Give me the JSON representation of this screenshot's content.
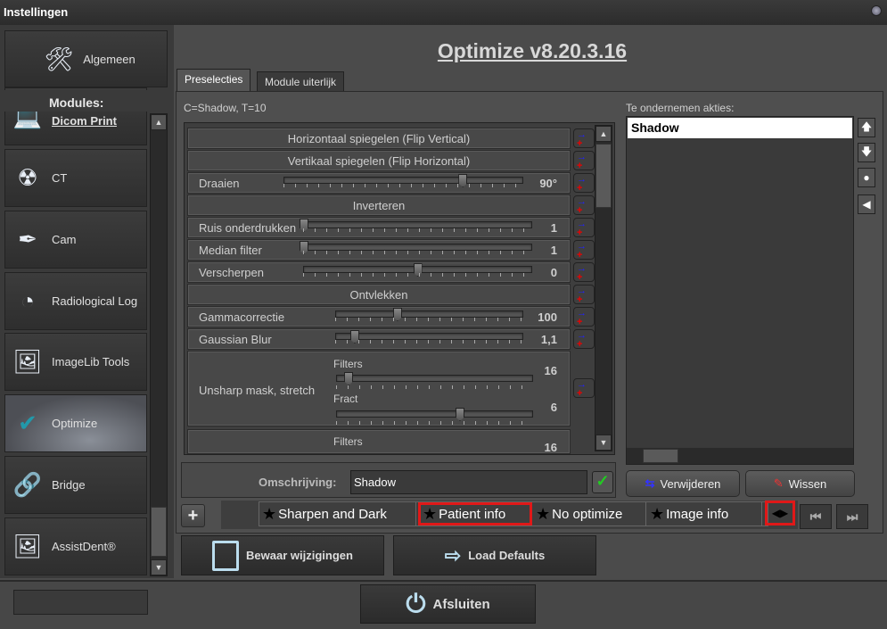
{
  "window": {
    "title": "Instellingen"
  },
  "sidebar": {
    "top_button": {
      "label": "Algemeen",
      "icon": "tools-icon"
    },
    "modules_label": "Modules:",
    "items": [
      {
        "label": "Dicom Print",
        "icon": "laptop-icon",
        "selected": false
      },
      {
        "label": "CT",
        "icon": "radiation-icon",
        "selected": false
      },
      {
        "label": "Cam",
        "icon": "camera-pen-icon",
        "icon_text": "CAM",
        "selected": false
      },
      {
        "label": "Radiological Log",
        "icon": "radiological-log-icon",
        "selected": false
      },
      {
        "label": "ImageLib Tools",
        "icon": "image-gear-icon",
        "selected": false
      },
      {
        "label": "Optimize",
        "icon": "checkmark-icon",
        "selected": true
      },
      {
        "label": "Bridge",
        "icon": "link-icon",
        "selected": false
      },
      {
        "label": "AssistDent®",
        "icon": "image-gear-icon",
        "selected": false
      }
    ]
  },
  "main": {
    "title": "Optimize v8.20.3.16",
    "tabs": [
      {
        "label": "Preselecties",
        "active": true
      },
      {
        "label": "Module uiterlijk",
        "active": false
      }
    ],
    "info": "C=Shadow, T=10",
    "rows": [
      {
        "type": "button",
        "label": "Horizontaal spiegelen (Flip Vertical)"
      },
      {
        "type": "button",
        "label": "Vertikaal spiegelen (Flip Horizontal)"
      },
      {
        "type": "slider",
        "label": "Draaien",
        "value": "90°",
        "fraction": 0.75
      },
      {
        "type": "button",
        "label": "Inverteren"
      },
      {
        "type": "slider",
        "label": "Ruis onderdrukken",
        "value": "1",
        "fraction": 0
      },
      {
        "type": "slider",
        "label": "Median filter",
        "value": "1",
        "fraction": 0
      },
      {
        "type": "slider",
        "label": "Verscherpen",
        "value": "0",
        "fraction": 0.5
      },
      {
        "type": "button",
        "label": "Ontvlekken"
      },
      {
        "type": "slider",
        "label": "Gammacorrectie",
        "value": "100",
        "fraction": 0.33
      },
      {
        "type": "slider",
        "label": "Gaussian Blur",
        "value": "1,1",
        "fraction": 0.1
      }
    ],
    "unsharp": {
      "label": "Unsharp mask, stretch",
      "filters_label": "Filters",
      "filters_value": "16",
      "filters_fraction": 0.06,
      "fract_label": "Fract",
      "fract_value": "6",
      "fract_fraction": 0.63
    },
    "partial_row": {
      "filters_label": "Filters",
      "filters_value": "16"
    },
    "description": {
      "label": "Omschrijving:",
      "value": "Shadow"
    },
    "actions": {
      "label": "Te ondernemen akties:",
      "items": [
        "Shadow"
      ],
      "remove_label": "Verwijderen",
      "clear_label": "Wissen"
    },
    "presets": [
      {
        "label": "Sharpen and Dark",
        "highlighted": false
      },
      {
        "label": "Patient info",
        "highlighted": true
      },
      {
        "label": "No optimize",
        "highlighted": false
      },
      {
        "label": "Image info",
        "highlighted": false
      }
    ],
    "add_label": "+",
    "save_label": "Bewaar wijzigingen",
    "defaults_label": "Load Defaults"
  },
  "footer": {
    "exit_label": "Afsluiten"
  },
  "colors": {
    "highlight": "#e01818",
    "title": "#d8d8d8",
    "background": "#4b4b4b"
  }
}
